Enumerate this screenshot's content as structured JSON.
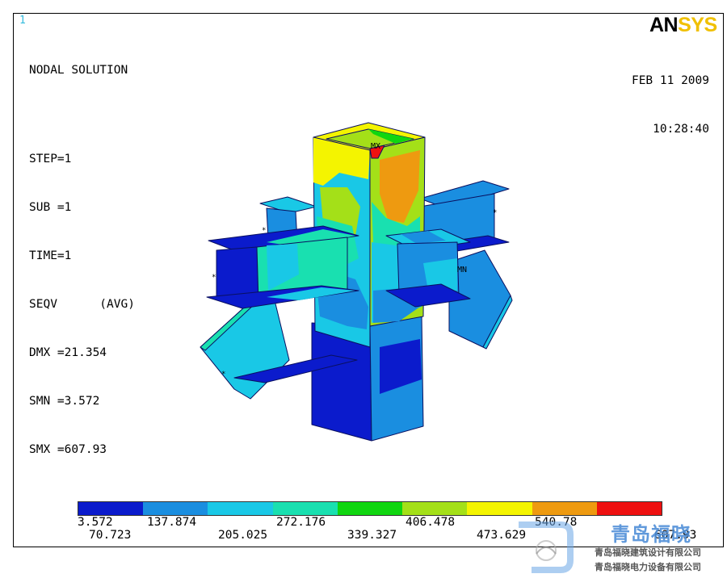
{
  "window_number": "1",
  "brand": {
    "part1": "AN",
    "part2": "SYS"
  },
  "info": {
    "title": "NODAL SOLUTION",
    "step": "STEP=1",
    "sub": "SUB =1",
    "time": "TIME=1",
    "seqv": "SEQV      (AVG)",
    "dmx": "DMX =21.354",
    "smn": "SMN =3.572",
    "smx": "SMX =607.93"
  },
  "datetime": {
    "date": "FEB 11 2009",
    "time": "10:28:40"
  },
  "markers": {
    "max": "MX",
    "min": "MN"
  },
  "legend": {
    "colors": [
      "#0b1bcc",
      "#1a8ee0",
      "#19c8e6",
      "#19e0b0",
      "#10d610",
      "#a4e018",
      "#f4f400",
      "#ee9a10",
      "#ee1010"
    ],
    "top_labels": [
      "3.572",
      "137.874",
      "272.176",
      "406.478",
      "540.78"
    ],
    "bottom_labels": [
      "70.723",
      "205.025",
      "339.327",
      "473.629",
      "607.93"
    ]
  },
  "watermark": {
    "name": "青岛福晓",
    "line1": "青岛福晓建筑设计有限公司",
    "line2": "青岛福晓电力设备有限公司"
  }
}
